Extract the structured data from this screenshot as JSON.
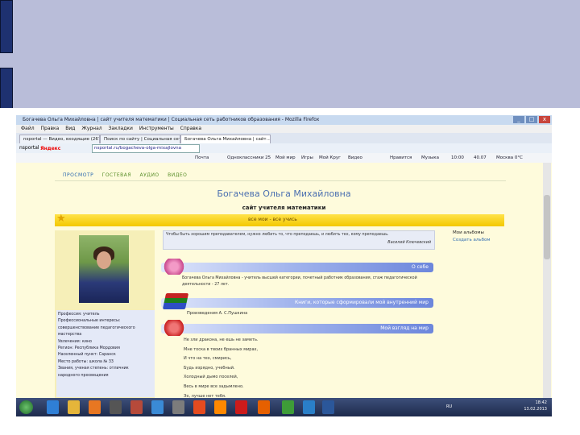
{
  "window": {
    "title": "Богачева Ольга Михайловна | сайт учителя математики | Социальная сеть работников образования - Mozilla Firefox",
    "controls": {
      "minimize": "_",
      "maximize": "□",
      "close": "x"
    }
  },
  "menubar": [
    "Файл",
    "Правка",
    "Вид",
    "Журнал",
    "Закладки",
    "Инструменты",
    "Справка"
  ],
  "tabs": [
    {
      "label": "nsportal — Видео, входящие (267) на..."
    },
    {
      "label": "Поиск по сайту | Социальная сеть р..."
    },
    {
      "label": "Богачева Ольга Михайловна | сайт..."
    }
  ],
  "navbar": {
    "search_prefix": "nsportal",
    "yandex": "Яндекс",
    "url": "nsportal.ru/bogacheva-olga-mixajlovna"
  },
  "bookmarks": [
    "Почта",
    "Одноклассники 25",
    "Мой мир",
    "Игры",
    "Мой Круг",
    "Видео",
    "Нравится",
    "Музыка",
    "10:00",
    "40.07",
    "Москва 0°С"
  ],
  "site": {
    "nav": [
      "ПРОСМОТР",
      "ГОСТЕВАЯ",
      "АУДИО",
      "ВИДЕО"
    ],
    "name": "Богачева Ольга Михайловна",
    "slogan": "сайт учителя математики",
    "banner": "все мои - все учись",
    "quote": {
      "text": "Чтобы быть хорошим преподавателем, нужно любить то, что преподаешь, и любить тех, кому преподаешь.",
      "author": "Василий Ключевский"
    },
    "albums": {
      "title": "Мои альбомы",
      "link": "Создать альбом"
    },
    "sections": {
      "about": "О себе",
      "books": "Книги, которые сформировали мой внутренний мир",
      "view": "Мой взгляд на мир"
    },
    "about_text": "Богачева Ольга Михайловна - учитель высшей категории, почетный работник образования, стаж педагогической деятельности - 27 лет.",
    "books_text": "Произведения А. С.Пушкина",
    "poem": [
      "Не зли дракона, не ешь не заметь.",
      "Мне тоска в твоих бранных мирах,",
      "И что на тех, смирись,",
      "Будь изрядно, учебный.",
      "Холодный дымо поселей,",
      "Весь в мире все задымлено.",
      "Эх, лучше нет тебя."
    ],
    "info": [
      "Профессия: учитель",
      "Профессиональные интересы:",
      "совершенствование педагогического",
      "мастерства",
      "Увлечения: кино",
      "Регион: Республика Мордовия",
      "Населенный пункт: Саранск",
      "Место работы: школа № 33",
      "Звания, ученая степень: отличник",
      "народного просвещения"
    ]
  },
  "taskbar": {
    "apps": [
      {
        "icon": "ie-icon",
        "color": "#2f7fd6"
      },
      {
        "icon": "folder-icon",
        "color": "#e5b53a"
      },
      {
        "icon": "media-player-icon",
        "color": "#e87722"
      },
      {
        "icon": "film-icon",
        "color": "#555555"
      },
      {
        "icon": "tool-icon",
        "color": "#b64a3a"
      },
      {
        "icon": "mail-icon",
        "color": "#3a8ad6"
      },
      {
        "icon": "tool2-icon",
        "color": "#7c7c7c"
      },
      {
        "icon": "calc-icon",
        "color": "#e54b1f"
      },
      {
        "icon": "vlc-icon",
        "color": "#ff8800"
      },
      {
        "icon": "opera-icon",
        "color": "#cc1b1b"
      },
      {
        "icon": "firefox-icon",
        "color": "#e66000"
      },
      {
        "icon": "chrome-icon",
        "color": "#3e9c38"
      },
      {
        "icon": "earth-icon",
        "color": "#2a7fc8"
      },
      {
        "icon": "word-icon",
        "color": "#2b579a"
      }
    ],
    "lang": "RU",
    "time": "18:42",
    "date": "13.02.2013"
  }
}
